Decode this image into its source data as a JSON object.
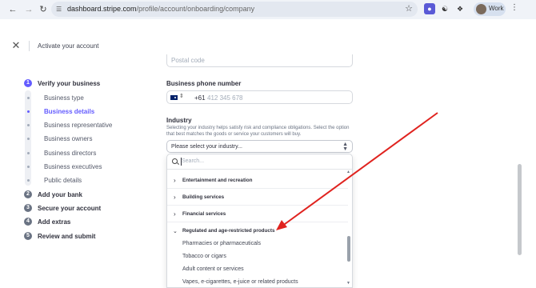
{
  "browser": {
    "url_host": "dashboard.stripe.com",
    "url_path": "/profile/account/onboarding/company",
    "profile_label": "Work"
  },
  "header": {
    "title": "Activate your account"
  },
  "steps": [
    {
      "number": "1",
      "label": "Verify your business",
      "color": "#635bff"
    },
    {
      "number": "2",
      "label": "Add your bank",
      "color": "#6a7383"
    },
    {
      "number": "3",
      "label": "Secure your account",
      "color": "#6a7383"
    },
    {
      "number": "4",
      "label": "Add extras",
      "color": "#6a7383"
    },
    {
      "number": "5",
      "label": "Review and submit",
      "color": "#6a7383"
    }
  ],
  "substeps": [
    {
      "label": "Business type",
      "active": false
    },
    {
      "label": "Business details",
      "active": true
    },
    {
      "label": "Business representative",
      "active": false
    },
    {
      "label": "Business owners",
      "active": false
    },
    {
      "label": "Business directors",
      "active": false
    },
    {
      "label": "Business executives",
      "active": false
    },
    {
      "label": "Public details",
      "active": false
    }
  ],
  "form": {
    "postal_placeholder": "Postal code",
    "phone_label": "Business phone number",
    "phone_prefix": "+61",
    "phone_placeholder": "412 345 678",
    "industry_label": "Industry",
    "industry_help": "Selecting your industry helps satisfy risk and compliance obligations. Select the option that best matches the goods or service your customers will buy.",
    "industry_select_value": "Please select your industry..."
  },
  "dropdown": {
    "search_placeholder": "Search...",
    "groups": [
      {
        "label": "Entertainment and recreation",
        "expanded": false
      },
      {
        "label": "Building services",
        "expanded": false
      },
      {
        "label": "Financial services",
        "expanded": false
      },
      {
        "label": "Regulated and age-restricted products",
        "expanded": true
      }
    ],
    "options": [
      "Pharmacies or pharmaceuticals",
      "Tobacco or cigars",
      "Adult content or services",
      "Vapes, e-cigarettes, e-juice or related products"
    ]
  },
  "colors": {
    "accent": "#635bff",
    "annotation_arrow": "#e0231f"
  }
}
